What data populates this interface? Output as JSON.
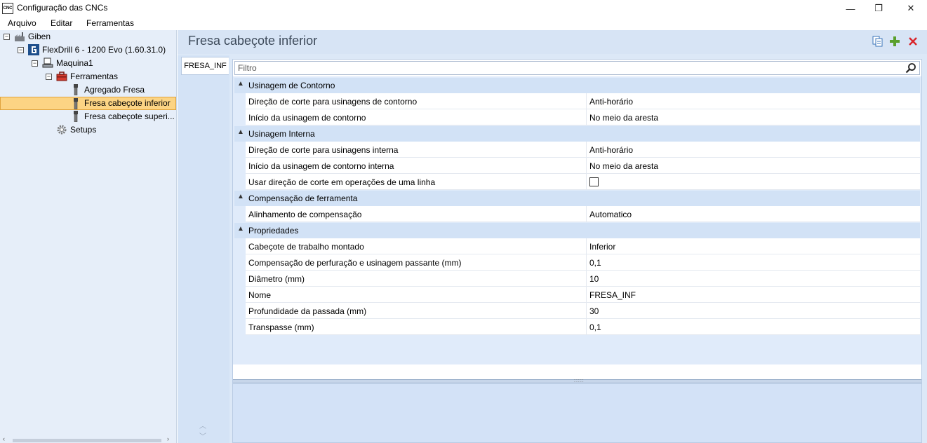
{
  "window": {
    "title": "Configuração das CNCs",
    "app_icon_text": "CNC",
    "minimize": "—",
    "maximize": "❐",
    "close": "✕"
  },
  "menu": [
    "Arquivo",
    "Editar",
    "Ferramentas"
  ],
  "tree": {
    "root": "Giben",
    "machine": "FlexDrill 6 - 1200 Evo (1.60.31.0)",
    "maquina": "Maquina1",
    "ferramentas": "Ferramentas",
    "tools": [
      "Agregado Fresa",
      "Fresa cabeçote inferior",
      "Fresa cabeçote superi..."
    ],
    "setups": "Setups",
    "expander_symbol": "−"
  },
  "main": {
    "title": "Fresa cabeçote inferior",
    "tab": "FRESA_INF",
    "filter_placeholder": "Filtro",
    "collapse_glyph": "▲"
  },
  "categories": [
    {
      "label": "Usinagem de Contorno",
      "props": [
        {
          "name": "Direção de corte para usinagens de contorno",
          "value": "Anti-horário"
        },
        {
          "name": "Início da usinagem de contorno",
          "value": "No meio da aresta"
        }
      ]
    },
    {
      "label": "Usinagem Interna",
      "props": [
        {
          "name": "Direção de corte para usinagens interna",
          "value": "Anti-horário"
        },
        {
          "name": "Início da usinagem de contorno interna",
          "value": "No meio da aresta"
        },
        {
          "name": "Usar direção de corte em operações de uma linha",
          "value": "",
          "checkbox": true
        }
      ]
    },
    {
      "label": "Compensação de ferramenta",
      "props": [
        {
          "name": "Alinhamento de compensação",
          "value": "Automatico"
        }
      ]
    },
    {
      "label": "Propriedades",
      "props": [
        {
          "name": "Cabeçote de trabalho montado",
          "value": "Inferior"
        },
        {
          "name": "Compensação de perfuração e usinagem passante (mm)",
          "value": "0,1"
        },
        {
          "name": "Diâmetro (mm)",
          "value": "10"
        },
        {
          "name": "Nome",
          "value": "FRESA_INF"
        },
        {
          "name": "Profundidade da passada (mm)",
          "value": "30"
        },
        {
          "name": "Transpasse (mm)",
          "value": "0,1"
        }
      ]
    }
  ],
  "colors": {
    "selection": "#fcd484",
    "accent_add": "#5aa02c",
    "accent_delete": "#d9262c"
  }
}
